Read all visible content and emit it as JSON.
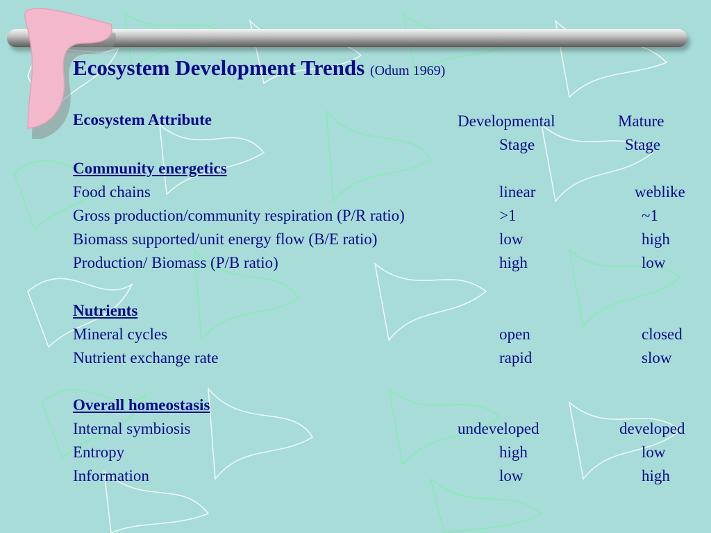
{
  "slide": {
    "title": "Ecosystem Development Trends",
    "citation": "(Odum 1969)",
    "header": {
      "attribute": "Ecosystem Attribute",
      "developmental_1": "Developmental",
      "developmental_2": "Stage",
      "mature_1": "Mature",
      "mature_2": "Stage"
    },
    "sections": {
      "energetics": {
        "heading": "Community energetics",
        "rows": [
          {
            "attribute": "Food chains",
            "developmental": "linear",
            "mature": "weblike"
          },
          {
            "attribute": "Gross production/community respiration (P/R ratio)",
            "developmental": ">1",
            "mature": "~1"
          },
          {
            "attribute": "Biomass supported/unit energy flow (B/E ratio)",
            "developmental": "low",
            "mature": "high"
          },
          {
            "attribute": "Production/ Biomass (P/B ratio)",
            "developmental": "high",
            "mature": "low"
          }
        ]
      },
      "nutrients": {
        "heading": "Nutrients",
        "rows": [
          {
            "attribute": "Mineral cycles",
            "developmental": "open",
            "mature": "closed"
          },
          {
            "attribute": "Nutrient exchange rate",
            "developmental": "rapid",
            "mature": "slow"
          }
        ]
      },
      "homeostasis": {
        "heading": "Overall homeostasis",
        "rows": [
          {
            "attribute": "Internal symbiosis",
            "developmental": "undeveloped",
            "mature": "developed"
          },
          {
            "attribute": "Entropy",
            "developmental": "high",
            "mature": "low"
          },
          {
            "attribute": "Information",
            "developmental": "low",
            "mature": "high"
          }
        ]
      }
    }
  },
  "colors": {
    "background": "#a8dcd8",
    "text": "#0a0a8c",
    "boomerang": "#f4b8cc",
    "bar": "#9a9a9a"
  }
}
